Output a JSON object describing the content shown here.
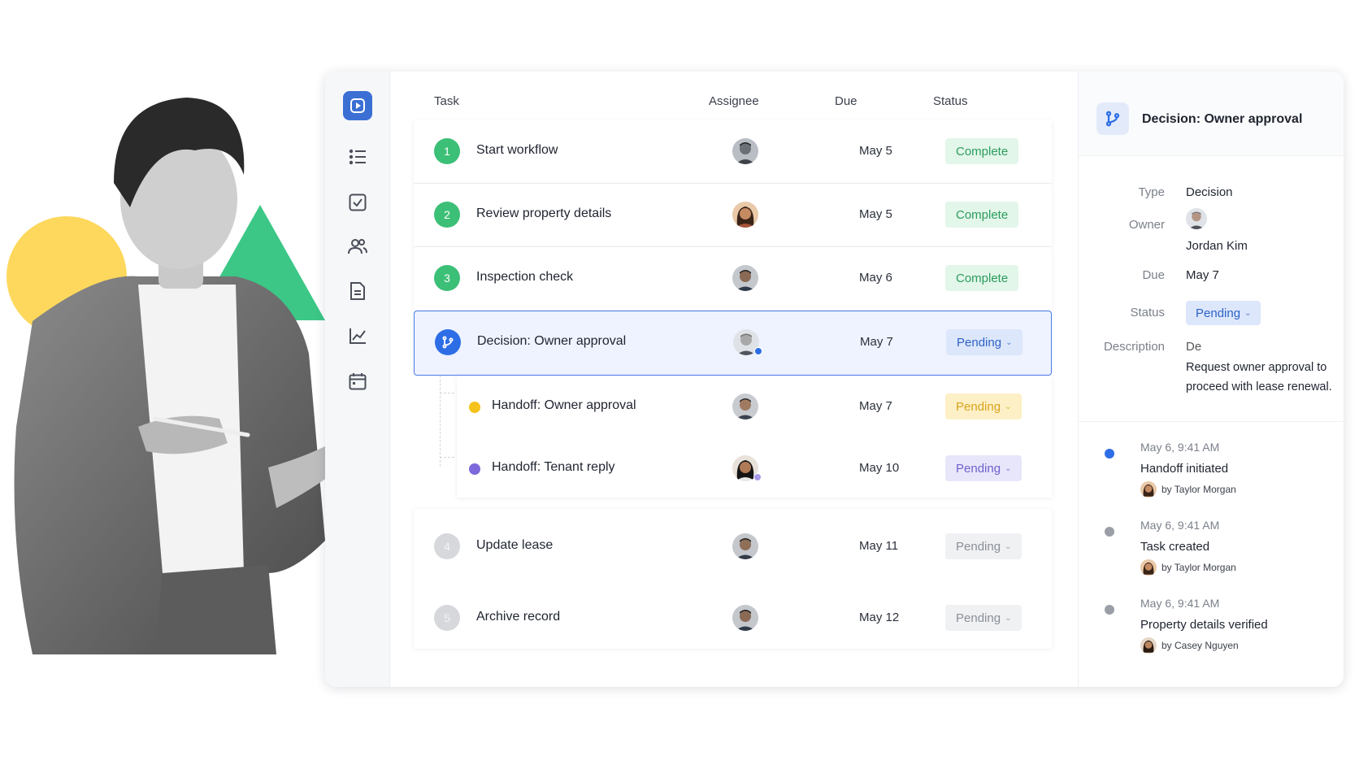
{
  "colors": {
    "accent": "#2d6ee6",
    "complete": "#3cbf76",
    "pending_yellow": "#f6c21c",
    "pending_purple": "#7d68dc",
    "hero_yellow": "#fdd85d",
    "hero_green": "#3cc787"
  },
  "icons": {
    "rail": [
      "play-logo-icon",
      "list-icon",
      "checkbox-icon",
      "users-icon",
      "document-icon",
      "chart-icon",
      "calendar-icon"
    ],
    "decision": "branch-icon"
  },
  "table": {
    "headers": {
      "task": "Task",
      "assignee": "Assignee",
      "due": "Due",
      "status": "Status"
    },
    "rows": [
      {
        "step": "1",
        "name": "Start workflow",
        "due": "May 5",
        "status": "Complete"
      },
      {
        "step": "2",
        "name": "Review property details",
        "due": "May 5",
        "status": "Complete"
      },
      {
        "step": "3",
        "name": "Inspection check",
        "due": "May 6",
        "status": "Complete"
      },
      {
        "step": "",
        "name": "Decision: Owner approval",
        "due": "May 7",
        "status": "Pending"
      },
      {
        "step": "",
        "name": "Handoff: Owner approval",
        "due": "May 7",
        "status": "Pending"
      },
      {
        "step": "",
        "name": "Handoff: Tenant reply",
        "due": "May 10",
        "status": "Pending"
      },
      {
        "step": "4",
        "name": "Update lease",
        "due": "May 11",
        "status": "Pending"
      },
      {
        "step": "5",
        "name": "Archive record",
        "due": "May 12",
        "status": "Pending"
      }
    ]
  },
  "detail": {
    "title": "Decision: Owner approval",
    "labels": {
      "type": "Type",
      "owner": "Owner",
      "due": "Due",
      "status": "Status",
      "description": "Description"
    },
    "type": "Decision",
    "owner": "Jordan Kim",
    "due": "May 7",
    "status": "Pending",
    "description_prefix": "De",
    "description": "Request owner approval to proceed with lease renewal."
  },
  "timeline": [
    {
      "time": "May 6, 9:41 AM",
      "event": "Handoff initiated",
      "by": "by Taylor Morgan"
    },
    {
      "time": "May 6, 9:41 AM",
      "event": "Task created",
      "by": "by Taylor Morgan"
    },
    {
      "time": "May 6, 9:41 AM",
      "event": "Property details verified",
      "by": "by Casey Nguyen"
    }
  ]
}
